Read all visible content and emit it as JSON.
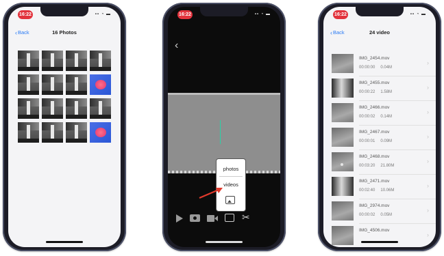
{
  "phone1": {
    "status_time": "16:22",
    "back_label": "Back",
    "title": "16 Photos",
    "photos": [
      "mono",
      "mono",
      "mono",
      "mono",
      "mono",
      "mono",
      "mono",
      "thermal",
      "mono",
      "mono",
      "mono",
      "mono",
      "mono",
      "mono",
      "mono",
      "thermal"
    ]
  },
  "phone2": {
    "status_time": "16:22",
    "menu": {
      "photos_label": "photos",
      "videos_label": "videos"
    },
    "arrow_color": "#e23a2c",
    "toolbar_icons": [
      "play-icon",
      "camera-icon",
      "video-camera-icon",
      "gallery-icon",
      "scissors-icon"
    ]
  },
  "phone3": {
    "status_time": "16:22",
    "back_label": "Back",
    "title": "24 video",
    "videos": [
      {
        "name": "IMG_2454.mov",
        "duration": "00:00:00",
        "size": "0.04M"
      },
      {
        "name": "IMG_2455.mov",
        "duration": "00:00:22",
        "size": "1.58M"
      },
      {
        "name": "IMG_2466.mov",
        "duration": "00:00:02",
        "size": "0.14M"
      },
      {
        "name": "IMG_2467.mov",
        "duration": "00:00:01",
        "size": "0.09M"
      },
      {
        "name": "IMG_2468.mov",
        "duration": "00:03:20",
        "size": "21.80M"
      },
      {
        "name": "IMG_2471.mov",
        "duration": "00:02:40",
        "size": "10.06M"
      },
      {
        "name": "IMG_2974.mov",
        "duration": "00:00:02",
        "size": "0.05M"
      },
      {
        "name": "IMG_4506.mov",
        "duration": "",
        "size": ""
      }
    ]
  },
  "colors": {
    "accent_blue": "#2a7bf4",
    "status_red": "#e2333d",
    "thermal_blue": "#2a57d6",
    "thermal_pink": "#ff6f8a"
  }
}
